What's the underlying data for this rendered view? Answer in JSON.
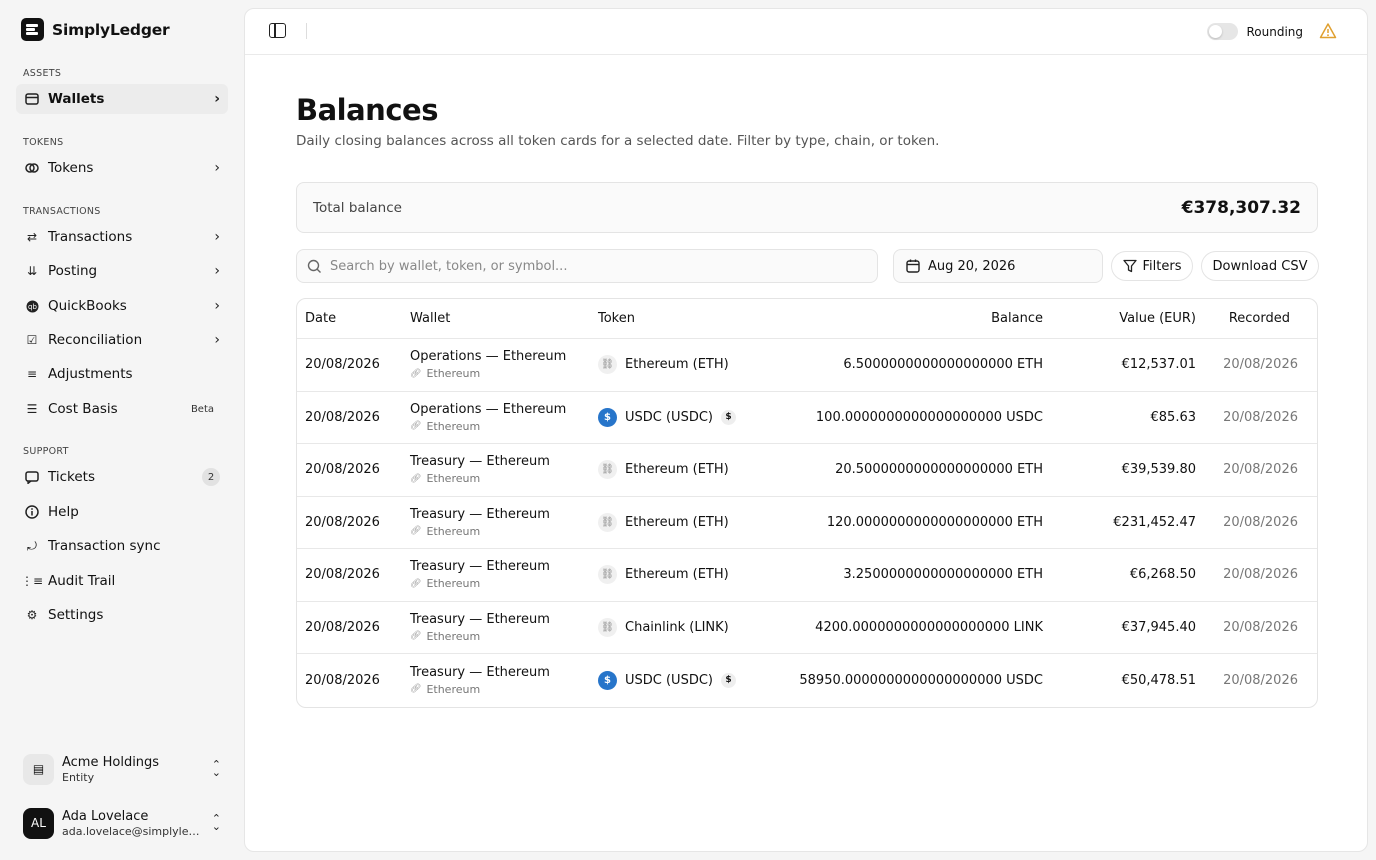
{
  "brand": {
    "name": "SimplyLedger"
  },
  "sidebar": {
    "sections": [
      {
        "label": "ASSETS",
        "items": [
          {
            "label": "Wallets",
            "icon": "wallet-icon",
            "chevron": true,
            "active": true
          }
        ]
      },
      {
        "label": "TOKENS",
        "items": [
          {
            "label": "Tokens",
            "icon": "coins-icon",
            "chevron": true
          }
        ]
      },
      {
        "label": "TRANSACTIONS",
        "items": [
          {
            "label": "Transactions",
            "icon": "arrows-icon",
            "chevron": true
          },
          {
            "label": "Posting",
            "icon": "posting-icon",
            "chevron": true
          },
          {
            "label": "QuickBooks",
            "icon": "quickbooks-icon",
            "chevron": true
          },
          {
            "label": "Reconciliation",
            "icon": "reconcile-icon",
            "chevron": true
          },
          {
            "label": "Adjustments",
            "icon": "sliders-icon"
          },
          {
            "label": "Cost Basis",
            "icon": "list-icon",
            "badge": "Beta"
          }
        ]
      },
      {
        "label": "SUPPORT",
        "items": [
          {
            "label": "Tickets",
            "icon": "message-icon",
            "count": "2"
          },
          {
            "label": "Help",
            "icon": "info-icon"
          },
          {
            "label": "Transaction sync",
            "icon": "sync-icon"
          },
          {
            "label": "Audit Trail",
            "icon": "audit-icon"
          },
          {
            "label": "Settings",
            "icon": "gear-icon"
          }
        ]
      }
    ],
    "entity": {
      "name": "Acme Holdings",
      "sub": "Entity"
    },
    "user": {
      "initials": "AL",
      "name": "Ada Lovelace",
      "email": "ada.lovelace@simplyledger.com"
    }
  },
  "topbar": {
    "rounding_label": "Rounding",
    "warning_color": "#e0a030"
  },
  "page": {
    "title": "Balances",
    "subtitle": "Daily closing balances across all token cards for a selected date. Filter by type, chain, or token."
  },
  "total": {
    "label": "Total balance",
    "value": "€378,307.32"
  },
  "toolbar": {
    "search_placeholder": "Search by wallet, token, or symbol...",
    "date": "Aug 20, 2026",
    "filters_label": "Filters",
    "csv_label": "Download CSV"
  },
  "table": {
    "headers": {
      "date": "Date",
      "wallet": "Wallet",
      "token": "Token",
      "balance": "Balance",
      "value": "Value (EUR)",
      "recorded": "Recorded"
    },
    "rows": [
      {
        "date": "20/08/2026",
        "wallet": "Operations — Ethereum",
        "chain": "Ethereum",
        "token": "Ethereum (ETH)",
        "token_type": "link",
        "balance": "6.5000000000000000000 ETH",
        "value": "€12,537.01",
        "recorded": "20/08/2026"
      },
      {
        "date": "20/08/2026",
        "wallet": "Operations — Ethereum",
        "chain": "Ethereum",
        "token": "USDC (USDC)",
        "token_type": "usdc",
        "balance": "100.0000000000000000000 USDC",
        "value": "€85.63",
        "recorded": "20/08/2026"
      },
      {
        "date": "20/08/2026",
        "wallet": "Treasury — Ethereum",
        "chain": "Ethereum",
        "token": "Ethereum (ETH)",
        "token_type": "link",
        "balance": "20.5000000000000000000 ETH",
        "value": "€39,539.80",
        "recorded": "20/08/2026"
      },
      {
        "date": "20/08/2026",
        "wallet": "Treasury — Ethereum",
        "chain": "Ethereum",
        "token": "Ethereum (ETH)",
        "token_type": "link",
        "balance": "120.0000000000000000000 ETH",
        "value": "€231,452.47",
        "recorded": "20/08/2026"
      },
      {
        "date": "20/08/2026",
        "wallet": "Treasury — Ethereum",
        "chain": "Ethereum",
        "token": "Ethereum (ETH)",
        "token_type": "link",
        "balance": "3.2500000000000000000 ETH",
        "value": "€6,268.50",
        "recorded": "20/08/2026"
      },
      {
        "date": "20/08/2026",
        "wallet": "Treasury — Ethereum",
        "chain": "Ethereum",
        "token": "Chainlink (LINK)",
        "token_type": "link",
        "balance": "4200.0000000000000000000 LINK",
        "value": "€37,945.40",
        "recorded": "20/08/2026"
      },
      {
        "date": "20/08/2026",
        "wallet": "Treasury — Ethereum",
        "chain": "Ethereum",
        "token": "USDC (USDC)",
        "token_type": "usdc",
        "balance": "58950.0000000000000000000 USDC",
        "value": "€50,478.51",
        "recorded": "20/08/2026"
      }
    ]
  }
}
